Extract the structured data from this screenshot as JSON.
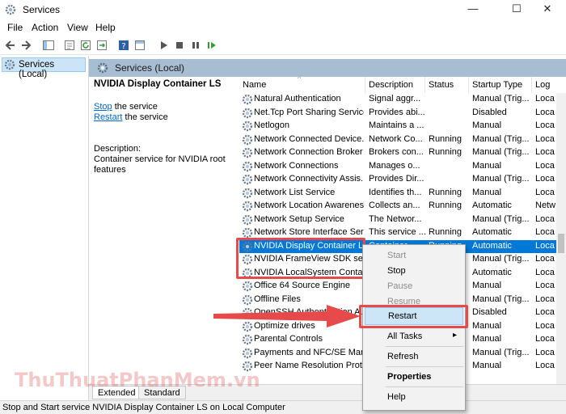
{
  "window": {
    "title": "Services",
    "controls": [
      "—",
      "☐",
      "✕"
    ]
  },
  "menu": [
    "File",
    "Action",
    "View",
    "Help"
  ],
  "tree": {
    "root_label": "Services (Local)"
  },
  "main_header": {
    "label": "Services (Local)"
  },
  "detail": {
    "service_name": "NVIDIA Display Container LS",
    "stop_link": "Stop",
    "stop_suffix": " the service",
    "restart_link": "Restart",
    "restart_suffix": " the service",
    "description_label": "Description:",
    "description_lines": [
      "Container service for NVIDIA root",
      "features"
    ]
  },
  "columns": [
    "Name",
    "Description",
    "Status",
    "Startup Type",
    "Log"
  ],
  "rows": [
    {
      "name": "Natural Authentication",
      "desc": "Signal aggr...",
      "status": "",
      "startup": "Manual (Trig...",
      "log": "Loca"
    },
    {
      "name": "Net.Tcp Port Sharing Service",
      "desc": "Provides abi...",
      "status": "",
      "startup": "Disabled",
      "log": "Loca"
    },
    {
      "name": "Netlogon",
      "desc": "Maintains a ...",
      "status": "",
      "startup": "Manual",
      "log": "Loca"
    },
    {
      "name": "Network Connected Device...",
      "desc": "Network Co...",
      "status": "Running",
      "startup": "Manual (Trig...",
      "log": "Loca"
    },
    {
      "name": "Network Connection Broker",
      "desc": "Brokers con...",
      "status": "Running",
      "startup": "Manual (Trig...",
      "log": "Loca"
    },
    {
      "name": "Network Connections",
      "desc": "Manages o...",
      "status": "",
      "startup": "Manual",
      "log": "Loca"
    },
    {
      "name": "Network Connectivity Assis...",
      "desc": "Provides Dir...",
      "status": "",
      "startup": "Manual (Trig...",
      "log": "Loca"
    },
    {
      "name": "Network List Service",
      "desc": "Identifies th...",
      "status": "Running",
      "startup": "Manual",
      "log": "Loca"
    },
    {
      "name": "Network Location Awareness",
      "desc": "Collects an...",
      "status": "Running",
      "startup": "Automatic",
      "log": "Netw"
    },
    {
      "name": "Network Setup Service",
      "desc": "The Networ...",
      "status": "",
      "startup": "Manual (Trig...",
      "log": "Loca"
    },
    {
      "name": "Network Store Interface Ser...",
      "desc": "This service ...",
      "status": "Running",
      "startup": "Automatic",
      "log": "Loca"
    },
    {
      "name": "NVIDIA Display Container LS",
      "desc": "Container...",
      "status": "Running",
      "startup": "Automatic",
      "log": "Loca"
    },
    {
      "name": "NVIDIA FrameView SDK serv...",
      "desc": "",
      "status": "",
      "startup": "Manual (Trig...",
      "log": "Loca"
    },
    {
      "name": "NVIDIA LocalSystem Contai...",
      "desc": "",
      "status": "",
      "startup": "Automatic",
      "log": "Loca"
    },
    {
      "name": "Office 64 Source Engine",
      "desc": "",
      "status": "",
      "startup": "Manual",
      "log": "Loca"
    },
    {
      "name": "Offline Files",
      "desc": "",
      "status": "",
      "startup": "Manual (Trig...",
      "log": "Loca"
    },
    {
      "name": "OpenSSH Authentication A...",
      "desc": "",
      "status": "",
      "startup": "Disabled",
      "log": "Loca"
    },
    {
      "name": "Optimize drives",
      "desc": "",
      "status": "",
      "startup": "Manual",
      "log": "Loca"
    },
    {
      "name": "Parental Controls",
      "desc": "",
      "status": "",
      "startup": "Manual",
      "log": "Loca"
    },
    {
      "name": "Payments and NFC/SE Man...",
      "desc": "",
      "status": "",
      "startup": "Manual (Trig...",
      "log": "Loca"
    },
    {
      "name": "Peer Name Resolution Prot...",
      "desc": "",
      "status": "",
      "startup": "Manual",
      "log": "Loca"
    }
  ],
  "selected_row_index": 11,
  "context_menu": {
    "start": "Start",
    "stop": "Stop",
    "pause": "Pause",
    "resume": "Resume",
    "restart": "Restart",
    "all_tasks": "All Tasks",
    "refresh": "Refresh",
    "properties": "Properties",
    "help": "Help"
  },
  "tabs": [
    "Extended",
    "Standard"
  ],
  "status_text": "Stop and Start service NVIDIA Display Container LS on Local Computer",
  "watermark": "ThuThuatPhanMem.vn",
  "colors": {
    "selection": "#0078d7",
    "header_band": "#a6bdd2",
    "link": "#0066cc",
    "highlight_box": "#e64a4a",
    "menu_hover": "#cde6f7"
  }
}
